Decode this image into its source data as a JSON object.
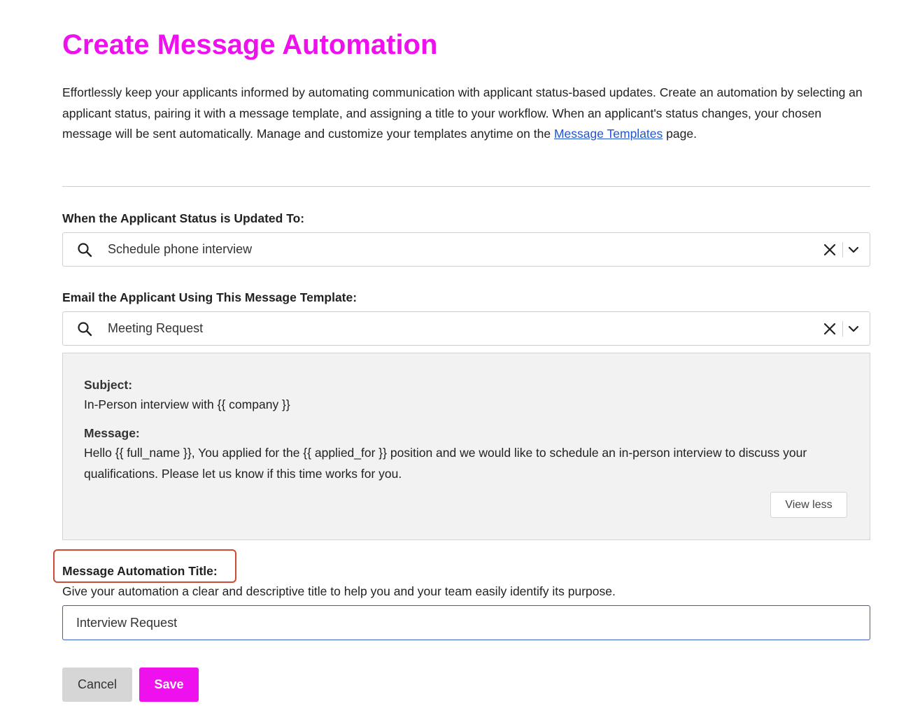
{
  "page": {
    "title": "Create Message Automation",
    "intro_text": "Effortlessly keep your applicants informed by automating communication with applicant status-based updates. Create an automation by selecting an applicant status, pairing it with a message template, and assigning a title to your workflow. When an applicant's status changes, your chosen message will be sent automatically. Manage and customize your templates anytime on the ",
    "intro_link": "Message Templates",
    "intro_tail": "page."
  },
  "status_field": {
    "label": "When the Applicant Status is Updated To:",
    "value": "Schedule phone interview"
  },
  "template_field": {
    "label": "Email the Applicant Using This Message Template:",
    "value": "Meeting Request"
  },
  "template_preview": {
    "subject_label": "Subject:",
    "subject": "In-Person interview with {{ company }}",
    "message_label": "Message:",
    "message": "Hello {{ full_name }}, You applied for the {{ applied_for }} position and we would like to schedule an in-person interview to discuss your qualifications. Please let us know if this time works for you.",
    "view_less_label": "View less"
  },
  "title_field": {
    "label": "Message Automation Title:",
    "help": "Give your automation a clear and descriptive title to help you and your team easily identify its purpose.",
    "value": "Interview Request"
  },
  "actions": {
    "cancel_label": "Cancel",
    "save_label": "Save"
  },
  "icons": {
    "search": "search-icon",
    "clear": "close-icon",
    "dropdown": "chevron-down-icon"
  },
  "colors": {
    "brand": "#ee11ee",
    "link": "#2255cc",
    "focus_border": "#3a5bbf",
    "highlight": "#cc4a36",
    "preview_bg": "#f2f2f2",
    "cancel_bg": "#d6d6d6"
  }
}
